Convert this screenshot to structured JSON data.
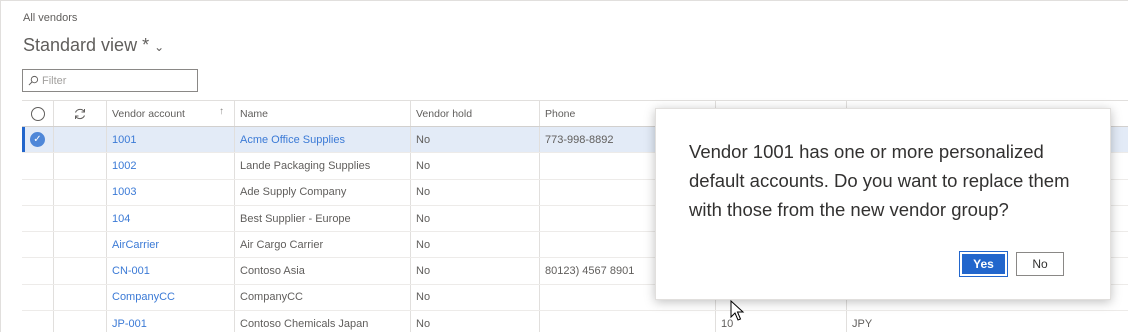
{
  "breadcrumb": "All vendors",
  "view": {
    "title": "Standard view *",
    "chevron": "chevron-down-icon"
  },
  "filter": {
    "placeholder": "Filter"
  },
  "grid": {
    "columns": [
      "Vendor account",
      "Name",
      "Vendor hold",
      "Phone"
    ],
    "rows": [
      {
        "account": "1001",
        "name": "Acme Office Supplies",
        "hold": "No",
        "phone": "773-998-8892",
        "group": "",
        "currency": "",
        "selected": true
      },
      {
        "account": "1002",
        "name": "Lande Packaging Supplies",
        "hold": "No",
        "phone": "",
        "group": "",
        "currency": ""
      },
      {
        "account": "1003",
        "name": "Ade Supply Company",
        "hold": "No",
        "phone": "",
        "group": "",
        "currency": ""
      },
      {
        "account": "104",
        "name": "Best Supplier - Europe",
        "hold": "No",
        "phone": "",
        "group": "",
        "currency": ""
      },
      {
        "account": "AirCarrier",
        "name": "Air Cargo Carrier",
        "hold": "No",
        "phone": "",
        "group": "",
        "currency": ""
      },
      {
        "account": "CN-001",
        "name": "Contoso Asia",
        "hold": "No",
        "phone": "80123) 4567 8901",
        "group": "",
        "currency": ""
      },
      {
        "account": "CompanyCC",
        "name": "CompanyCC",
        "hold": "No",
        "phone": "",
        "group": "",
        "currency": ""
      },
      {
        "account": "JP-001",
        "name": "Contoso Chemicals Japan",
        "hold": "No",
        "phone": "",
        "group": "10",
        "currency": "JPY"
      }
    ]
  },
  "dialog": {
    "message": "Vendor 1001 has one or more personalized default accounts. Do you want to replace them with those from the new vendor group?",
    "yes_label": "Yes",
    "no_label": "No"
  },
  "colors": {
    "accent": "#2266cc",
    "link": "#3b7ad6",
    "selected_row": "#e3ebf7"
  }
}
